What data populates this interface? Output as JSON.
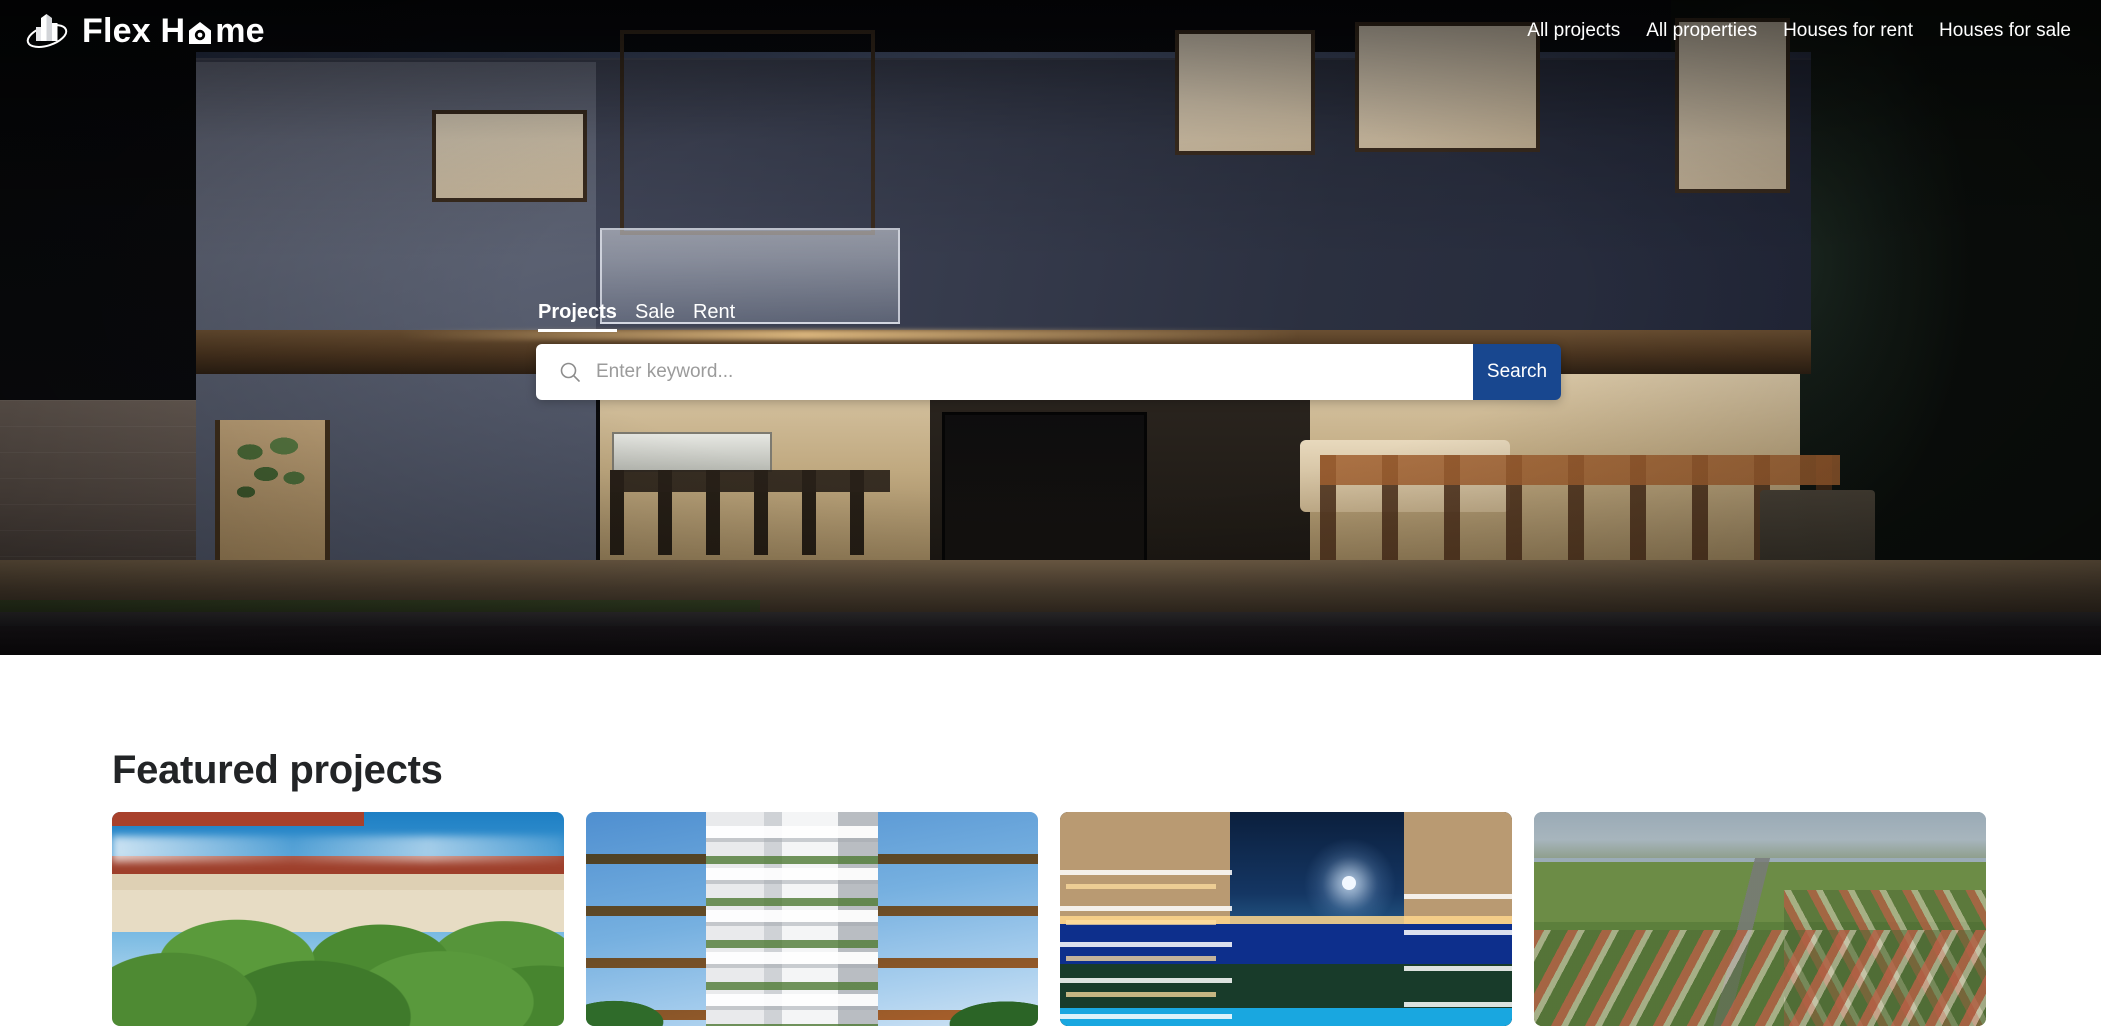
{
  "brand": {
    "name_part1": "Flex H",
    "name_part2": "me",
    "logo_icon": "building-orbit-logo-icon",
    "o_icon": "house-dot-icon"
  },
  "nav": {
    "items": [
      {
        "label": "All projects",
        "icon": "nav-link-icon"
      },
      {
        "label": "All properties",
        "icon": "nav-link-icon"
      },
      {
        "label": "Houses for rent",
        "icon": "nav-link-icon"
      },
      {
        "label": "Houses for sale",
        "icon": "nav-link-icon"
      }
    ]
  },
  "search": {
    "tabs": [
      {
        "label": "Projects",
        "active": true
      },
      {
        "label": "Sale",
        "active": false
      },
      {
        "label": "Rent",
        "active": false
      }
    ],
    "placeholder": "Enter keyword...",
    "value": "",
    "icon": "search-icon",
    "button_label": "Search",
    "button_color": "#18478f"
  },
  "featured": {
    "title": "Featured projects",
    "cards": [
      {
        "alt": "Hillside villas with red tile roofs surrounded by green trees under a blue sky"
      },
      {
        "alt": "Modern white residential high-rise tower with orange balconies and planted terraces"
      },
      {
        "alt": "Night render of a seaside residential complex with moonlit sea, city lights and a pool"
      },
      {
        "alt": "Aerial view of a suburban villa development with red roofs and green fields"
      }
    ]
  },
  "hero": {
    "alt": "Modern two-storey house at night with large glass walls and warm interior lighting"
  },
  "colors": {
    "accent_blue": "#18478f",
    "header_text": "#ffffff",
    "heading_text": "#222426",
    "page_background": "#ffffff"
  }
}
